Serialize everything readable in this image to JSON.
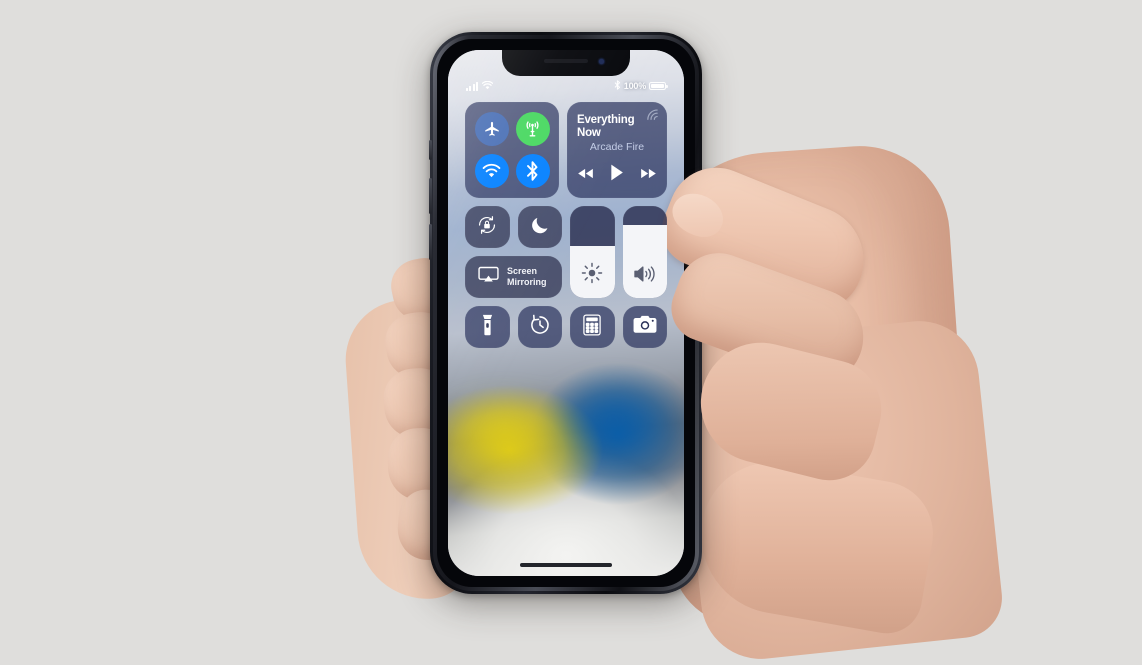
{
  "scene": {
    "background_color": "#dfdedc",
    "description": "Hand holding an iPhone X showing iOS Control Center"
  },
  "device": {
    "name": "iPhone X",
    "frame_color": "#1b1d24"
  },
  "status_bar": {
    "signal_icon": "cellular-bars-icon",
    "signal_bars": 4,
    "wifi_icon": "wifi-icon",
    "bluetooth_icon": "bluetooth-icon",
    "battery_percent": "100%",
    "battery_icon": "battery-full-icon"
  },
  "control_center": {
    "connectivity": {
      "tiles": [
        {
          "name": "airplane-mode",
          "icon": "airplane-icon",
          "state": "off",
          "color": "#4e73b8"
        },
        {
          "name": "cellular-data",
          "icon": "cellular-tower-icon",
          "state": "on",
          "color": "#4cd964"
        },
        {
          "name": "wifi",
          "icon": "wifi-icon",
          "state": "on",
          "color": "#0a84ff"
        },
        {
          "name": "bluetooth",
          "icon": "bluetooth-icon",
          "state": "on",
          "color": "#0a84ff"
        }
      ]
    },
    "media": {
      "title": "Everything Now",
      "artist": "Arcade Fire",
      "airplay_icon": "airplay-waves-icon",
      "controls": [
        {
          "name": "rewind-button",
          "icon": "rewind-icon"
        },
        {
          "name": "play-button",
          "icon": "play-icon"
        },
        {
          "name": "fast-forward-button",
          "icon": "fast-forward-icon"
        }
      ]
    },
    "toggles": [
      {
        "name": "rotation-lock",
        "icon": "rotation-lock-icon",
        "state": "off"
      },
      {
        "name": "do-not-disturb",
        "icon": "moon-icon",
        "state": "off"
      }
    ],
    "screen_mirroring": {
      "label_line1": "Screen",
      "label_line2": "Mirroring",
      "icon": "airplay-screen-icon"
    },
    "sliders": [
      {
        "name": "brightness-slider",
        "icon": "brightness-sun-icon",
        "value": 56
      },
      {
        "name": "volume-slider",
        "icon": "speaker-volume-icon",
        "value": 79
      }
    ],
    "shortcuts": [
      {
        "name": "flashlight",
        "icon": "flashlight-icon"
      },
      {
        "name": "timer",
        "icon": "timer-icon"
      },
      {
        "name": "calculator",
        "icon": "calculator-icon"
      },
      {
        "name": "camera",
        "icon": "camera-icon"
      }
    ]
  },
  "home_indicator": {
    "name": "home-indicator"
  }
}
